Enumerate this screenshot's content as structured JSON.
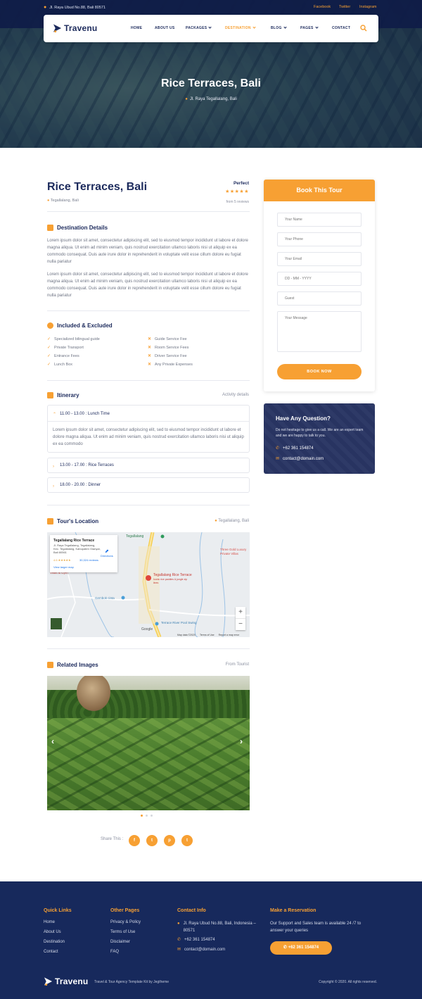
{
  "topbar": {
    "address": "Jl. Raya Ubud No.88, Bali 80571",
    "social": [
      "Facebook",
      "Twitter",
      "Instagram"
    ]
  },
  "brand": {
    "name": "Travenu"
  },
  "nav": {
    "items": [
      "HOME",
      "ABOUT US",
      "PACKAGES",
      "DESTINATION",
      "BLOG",
      "PAGES",
      "CONTACT"
    ],
    "active": "DESTINATION",
    "search_icon": "search-icon"
  },
  "hero": {
    "title": "Rice Terraces, Bali",
    "location": "Jl. Raya Tegallalang, Bali"
  },
  "destination": {
    "title": "Rice Terraces, Bali",
    "location": "Tegallalang, Bali",
    "rating_label": "Perfect",
    "stars": 5,
    "reviews": "from 5 reviews"
  },
  "details": {
    "heading": "Destination Details",
    "paragraphs": [
      "Lorem ipsum dolor sit amet, consectetur adipiscing elit, sed to eiusmod tempor incididunt ut labore et dolore magna aliqua. Ut enim ad minim veniam, quis nostrud exercitation ullamco laboris nisi ut aliquip ex ea commodo consequat. Duis aute irure dolor in reprehenderit in voluptate velit esse cillum dolore eu fugiat nulla pariatur",
      "Lorem ipsum dolor sit amet, consectetur adipiscing elit, sed to eiusmod tempor incididunt ut labore et dolore magna aliqua. Ut enim ad minim veniam, quis nostrud exercitation ullamco laboris nisi ut aliquip ex ea commodo consequat. Duis aute irure dolor in reprehenderit in voluptate velit esse cillum dolore eu fugiat nulla pariatur"
    ]
  },
  "included": {
    "heading": "Included & Excluded",
    "included": [
      "Specialized bilingual guide",
      "Private Transport",
      "Entrance Fees",
      "Lunch Box"
    ],
    "excluded": [
      "Guide Service Fee",
      "Room Service Fees",
      "Driver Service Fee",
      "Any Private Expenses"
    ]
  },
  "itinerary": {
    "heading": "Itinerary",
    "right_label": "Activity details",
    "items": [
      {
        "label": "11.00 - 13.00 : Lunch Time",
        "open": true,
        "body": "Lorem ipsum dolor sit amet, consectetur adipiscing elit, sed to eiusmod tempor incididunt ut labore et dolore magna aliqua. Ut enim ad minim veniam, quis nostrud exercitation ullamco laboris nisi ut aliquip ex ea commodo"
      },
      {
        "label": "13.00 - 17.00 : Rice Terraces",
        "open": false
      },
      {
        "label": "18.00 - 20.00 : Dinner",
        "open": false
      }
    ]
  },
  "location": {
    "heading": "Tour's Location",
    "right_label": "Tegallalang, Bali",
    "map": {
      "card_title": "Tegallalang Rice Terrace",
      "card_address": "Jl. Raya Tegallalang, Tegallalang, Kec. Tegallalang, Kabupaten Gianyar, Bali 80561",
      "rating": "4.6",
      "reviews": "30,324 reviews",
      "larger": "View larger map",
      "directions": "Directions",
      "labels": [
        "Tegallalang",
        "Three Gold Luxury Private Villas",
        "Villas & Gym",
        "Gembok cinta",
        "Tegallalang Rice Terrace",
        "Iconic rice paddies & jungle zip lines",
        "Terrace River Pool Swing",
        "Google"
      ],
      "footer": [
        "Map data ©2020",
        "Terms of Use",
        "Report a map error"
      ]
    }
  },
  "related": {
    "heading": "Related Images",
    "right_label": "From Tourist",
    "slides": 3,
    "active_slide": 0
  },
  "share": {
    "label": "Share This :",
    "buttons": [
      "f",
      "t",
      "p",
      "t"
    ]
  },
  "booking": {
    "heading": "Book This Tour",
    "fields": [
      {
        "name": "name",
        "placeholder": "Your Name"
      },
      {
        "name": "phone",
        "placeholder": "Your Phone"
      },
      {
        "name": "email",
        "placeholder": "Your Email"
      },
      {
        "name": "date",
        "placeholder": "DD - MM - YYYY"
      },
      {
        "name": "guest",
        "placeholder": "Guest"
      }
    ],
    "message_placeholder": "Your Message",
    "button": "BOOK NOW"
  },
  "question": {
    "heading": "Have Any Question?",
    "text": "Do not hesitage to give us a call. We are an expert team and we are happy to talk to you.",
    "phone": "+62 361 154874",
    "email": "contact@domain.com"
  },
  "footer": {
    "quick_links": {
      "heading": "Quick Links",
      "items": [
        "Home",
        "About Us",
        "Destination",
        "Contact"
      ]
    },
    "other_pages": {
      "heading": "Other Pages",
      "items": [
        "Privacy & Policy",
        "Terms of Use",
        "Disclaimer",
        "FAQ"
      ]
    },
    "contact": {
      "heading": "Contact Info",
      "address": "Jl. Raya Ubud No.88, Bali, Indonesia – 80571",
      "phone": "+62 361 154874",
      "email": "contact@domain.com"
    },
    "reservation": {
      "heading": "Make a Reservation",
      "text": "Our Support and Sales team is available 24 /7 to answer your queries",
      "button": "+62 361 154874"
    },
    "tagline": "Travel & Tour Agency Template Kit by Jegtheme",
    "copyright": "Copyright © 2020. All rights reserved."
  },
  "colors": {
    "accent": "#f7a033",
    "navy": "#1c2a5c",
    "footer_bg": "#17295c"
  }
}
